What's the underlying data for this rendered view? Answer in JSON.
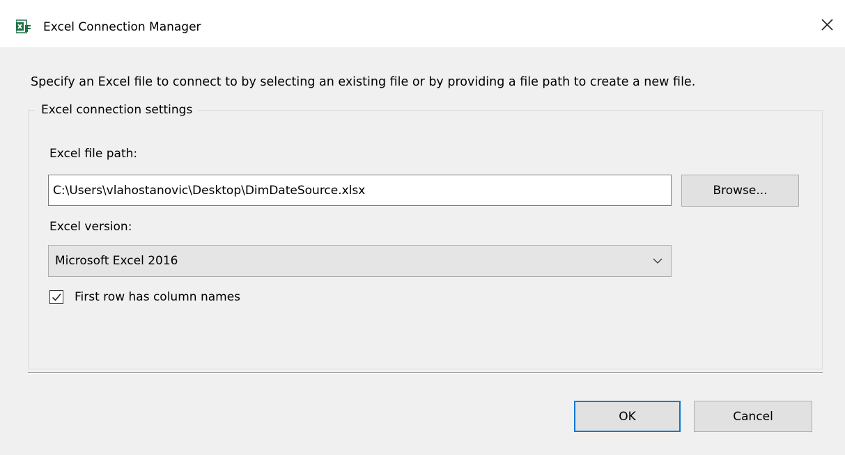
{
  "window": {
    "title": "Excel Connection Manager",
    "app_icon": "excel-icon",
    "close_icon": "close-icon"
  },
  "instructions": "Specify an Excel file to connect to by selecting an existing file or by providing a file path to create a new file.",
  "group": {
    "legend": "Excel connection settings",
    "file_path_label": "Excel file path:",
    "file_path_value": "C:\\Users\\vlahostanovic\\Desktop\\DimDateSource.xlsx",
    "browse_label": "Browse...",
    "version_label": "Excel version:",
    "version_selected": "Microsoft Excel 2016",
    "first_row_label": "First row has column names",
    "first_row_checked": true
  },
  "buttons": {
    "ok_label": "OK",
    "cancel_label": "Cancel"
  },
  "colors": {
    "accent": "#0078d7",
    "excel_green": "#1e7145",
    "client_background": "#f0f0f0"
  }
}
